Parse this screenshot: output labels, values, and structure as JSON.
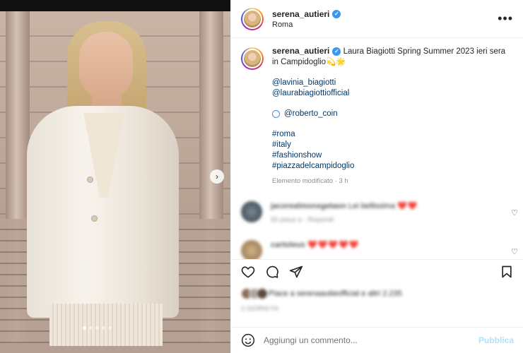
{
  "post": {
    "username": "serena_autieri",
    "location": "Roma",
    "caption": "Laura Biagiotti Spring Summer 2023 ieri sera in Campidoglio💫🌟",
    "mentions": [
      "@lavinia_biagiotti",
      "@laurabiagiottiofficial"
    ],
    "ring_mention": "@roberto_coin",
    "hashtags": [
      "#roma",
      "#italy",
      "#fashionshow",
      "#piazzadelcampidoglio"
    ],
    "meta": "Elemento modificato · 3 h"
  },
  "comments": [
    {
      "user": "jacorealmonsgetaon",
      "text": "Lei bellissima",
      "hearts": "❤️❤️",
      "sub": "55 piace a · Rispondi"
    },
    {
      "user": "cartoleus",
      "text": "",
      "hearts": "❤️❤️❤️❤️❤️",
      "sub": ""
    }
  ],
  "likes": {
    "text": "Piace a serenaautieofficial e altri 2.235"
  },
  "date": "2 GIORNI FA",
  "add_comment": {
    "placeholder": "Aggiungi un commento...",
    "publish": "Pubblica"
  },
  "photo": {
    "slide_count": 5,
    "active_slide": 1
  },
  "icons": {
    "more": "•••",
    "next": "›",
    "heart": "♡",
    "verified": "✓"
  },
  "colors": {
    "link": "#00376b",
    "verified": "#3897f0",
    "publish": "#b2dffc",
    "heart": "#ed4956"
  }
}
